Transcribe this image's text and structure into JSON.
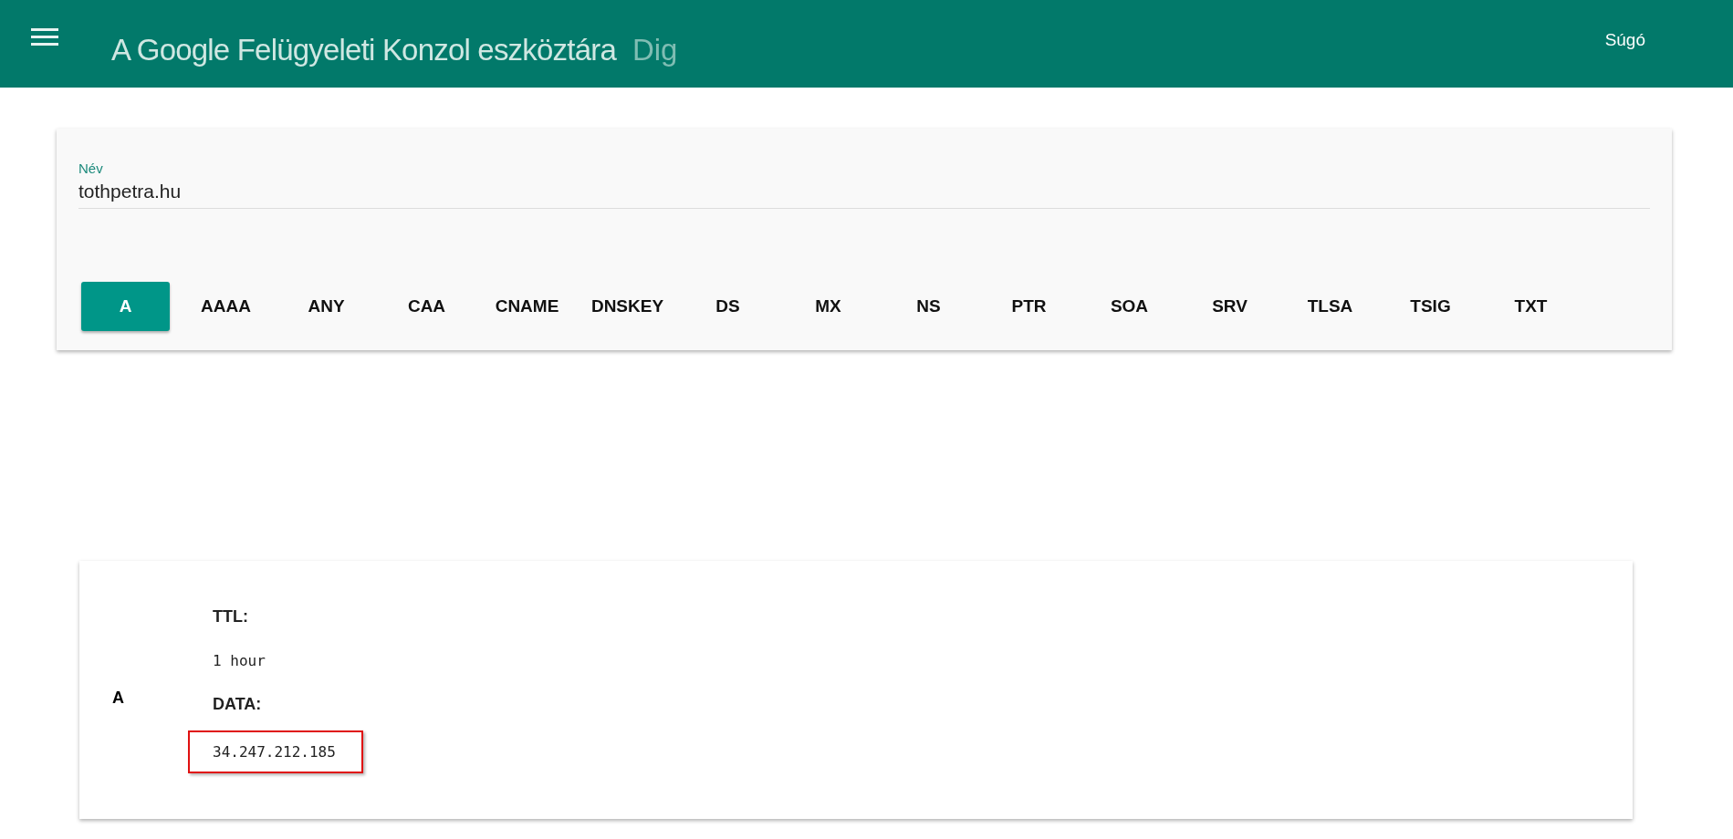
{
  "header": {
    "title": "A Google Felügyeleti Konzol eszköztára",
    "subtitle": "Dig",
    "help": "Súgó"
  },
  "query": {
    "label": "Név",
    "value": "tothpetra.hu"
  },
  "record_types": [
    {
      "label": "A",
      "selected": true
    },
    {
      "label": "AAAA",
      "selected": false
    },
    {
      "label": "ANY",
      "selected": false
    },
    {
      "label": "CAA",
      "selected": false
    },
    {
      "label": "CNAME",
      "selected": false
    },
    {
      "label": "DNSKEY",
      "selected": false
    },
    {
      "label": "DS",
      "selected": false
    },
    {
      "label": "MX",
      "selected": false
    },
    {
      "label": "NS",
      "selected": false
    },
    {
      "label": "PTR",
      "selected": false
    },
    {
      "label": "SOA",
      "selected": false
    },
    {
      "label": "SRV",
      "selected": false
    },
    {
      "label": "TLSA",
      "selected": false
    },
    {
      "label": "TSIG",
      "selected": false
    },
    {
      "label": "TXT",
      "selected": false
    }
  ],
  "result": {
    "type": "A",
    "fields": [
      {
        "label": "TTL:",
        "value": "1 hour",
        "highlighted": false
      },
      {
        "label": "DATA:",
        "value": "34.247.212.185",
        "highlighted": true
      }
    ]
  }
}
